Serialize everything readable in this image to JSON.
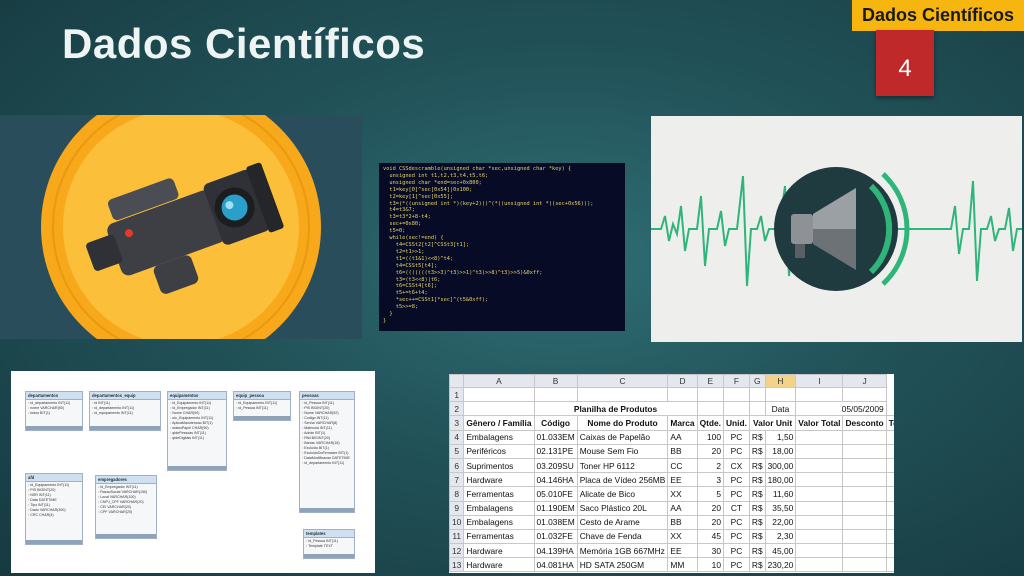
{
  "slide": {
    "title": "Dados Científicos",
    "section_tag": "Dados Científicos",
    "page_number": "4",
    "colors": {
      "accent_tag": "#f6b50f",
      "page_box": "#c0292a"
    }
  },
  "code_image": {
    "lines": [
      "void CSSdescramble(unsigned char *sec,unsigned char *key) {",
      "  unsigned int t1,t2,t3,t4,t5,t6;",
      "  unsigned char *end=sec+0x800;",
      "  t1=key[0]^sec[0x54]|0x100;",
      "  t2=key[1]^sec[0x55];",
      "  t3=(*((unsigned int *)(key+2)))^(*((unsigned int *)(sec+0x56)));",
      "  t4=t3&7;",
      "  t3=t3*2+8-t4;",
      "  sec+=0x80;",
      "  t5=0;",
      "  while(sec!=end) {",
      "    t4=CSSt2[t2]^CSSt3[t1];",
      "    t2=t1>>1;",
      "    t1=((t1&1)<<8)^t4;",
      "    t4=CSSt5[t4];",
      "    t6=(((((((t3>>3)^t3)>>1)^t3)>>8)^t3)>>5)&0xff;",
      "    t3=(t3<<8)|t6;",
      "    t6=CSSt4[t6];",
      "    t5+=t6+t4;",
      "    *sec++=CSSt1[*sec]^(t5&0xff);",
      "    t5>>=8;",
      "  }",
      "}"
    ]
  },
  "db_diagram": {
    "entities": [
      {
        "name": "departamentos",
        "fields": [
          "id_departamento INT(11)",
          "nome VARCHAR(50)",
          "todos BIT(1)"
        ]
      },
      {
        "name": "departamentos_equip",
        "fields": [
          "id INT(11)",
          "id_departamento INT(11)",
          "id_equipamento INT(11)"
        ]
      },
      {
        "name": "equipamentos",
        "fields": [
          "id_Equipamento INT(11)",
          "id_Empregador INT(11)",
          "Nome CHAR(90)",
          "utc_Equipamento INT(11)",
          "AplicaManutencao BIT(1)",
          "statusPapel CHAR(90)",
          "qtdePessoas INT(11)",
          "qtdeDigitais INT(11)"
        ]
      },
      {
        "name": "equip_pessoa",
        "fields": [
          "id_Equipamento INT(11)",
          "id_Pessoa INT(11)"
        ]
      },
      {
        "name": "pessoas",
        "fields": [
          "id_Pessoa INT(11)",
          "PIS BIGINT(20)",
          "Nome VARCHAR(52)",
          "Codigo INT(11)",
          "Senha VARCHAR(8)",
          "Matricula INT(11)",
          "Admin BIT(1)",
          "Rfid BIGINT(20)",
          "Barras VARCHAR(18)",
          "Excluido BIT(1)",
          "ExcluidoDoFirmware BIT(1)",
          "DataModificacao DATETIME",
          "id_departamento INT(11)"
        ]
      },
      {
        "name": "afd",
        "fields": [
          "id_Equipamento INT(11)",
          "PIS BIGINT(20)",
          "NSR INT(11)",
          "Data DATETIME",
          "Tipo INT(11)",
          "Dado VARCHAR(300)",
          "CRC CHAR(4)"
        ]
      },
      {
        "name": "empregadores",
        "fields": [
          "id_Empregador INT(11)",
          "RazaoSocial VARCHAR(150)",
          "Local VARCHAR(100)",
          "CNPJ_CPF VARCHAR(20)",
          "CEI VARCHAR(20)",
          "CPF VARCHAR(20)"
        ]
      },
      {
        "name": "templates",
        "fields": [
          "id_Pessoa INT(11)",
          "Template TEXT"
        ]
      }
    ]
  },
  "spreadsheet": {
    "col_headers": [
      "A",
      "B",
      "C",
      "D",
      "E",
      "F",
      "G",
      "H",
      "I",
      "J"
    ],
    "title": "Planilha de Produtos",
    "date_label": "Data",
    "date_value": "05/05/2009",
    "headers": [
      "Gênero / Família",
      "Código",
      "Nome do Produto",
      "Marca",
      "Qtde.",
      "Unid.",
      "Valor Unit",
      "Valor Total",
      "Desconto",
      "Total c/ Desc"
    ],
    "rows": [
      {
        "n": "4",
        "genero": "Embalagens",
        "codigo": "01.033EM",
        "nome": "Caixas de Papelão",
        "marca": "AA",
        "qtde": "100",
        "unid": "PC",
        "cur": "R$",
        "valor": "1,50"
      },
      {
        "n": "5",
        "genero": "Periféricos",
        "codigo": "02.131PE",
        "nome": "Mouse Sem Fio",
        "marca": "BB",
        "qtde": "20",
        "unid": "PC",
        "cur": "R$",
        "valor": "18,00"
      },
      {
        "n": "6",
        "genero": "Suprimentos",
        "codigo": "03.209SU",
        "nome": "Toner HP 6112",
        "marca": "CC",
        "qtde": "2",
        "unid": "CX",
        "cur": "R$",
        "valor": "300,00"
      },
      {
        "n": "7",
        "genero": "Hardware",
        "codigo": "04.146HA",
        "nome": "Placa de Vídeo 256MB",
        "marca": "EE",
        "qtde": "3",
        "unid": "PC",
        "cur": "R$",
        "valor": "180,00"
      },
      {
        "n": "8",
        "genero": "Ferramentas",
        "codigo": "05.010FE",
        "nome": "Alicate de Bico",
        "marca": "XX",
        "qtde": "5",
        "unid": "PC",
        "cur": "R$",
        "valor": "11,60"
      },
      {
        "n": "9",
        "genero": "Embalagens",
        "codigo": "01.190EM",
        "nome": "Saco Plástico 20L",
        "marca": "AA",
        "qtde": "20",
        "unid": "CT",
        "cur": "R$",
        "valor": "35,50"
      },
      {
        "n": "10",
        "genero": "Embalagens",
        "codigo": "01.038EM",
        "nome": "Cesto de Arame",
        "marca": "BB",
        "qtde": "20",
        "unid": "PC",
        "cur": "R$",
        "valor": "22,00"
      },
      {
        "n": "11",
        "genero": "Ferramentas",
        "codigo": "01.032FE",
        "nome": "Chave de Fenda",
        "marca": "XX",
        "qtde": "45",
        "unid": "PC",
        "cur": "R$",
        "valor": "2,30"
      },
      {
        "n": "12",
        "genero": "Hardware",
        "codigo": "04.139HA",
        "nome": "Memória 1GB 667MHz",
        "marca": "EE",
        "qtde": "30",
        "unid": "PC",
        "cur": "R$",
        "valor": "45,00"
      },
      {
        "n": "13",
        "genero": "Hardware",
        "codigo": "04.081HA",
        "nome": "HD SATA 250GM",
        "marca": "MM",
        "qtde": "10",
        "unid": "PC",
        "cur": "R$",
        "valor": "230,20"
      }
    ]
  }
}
